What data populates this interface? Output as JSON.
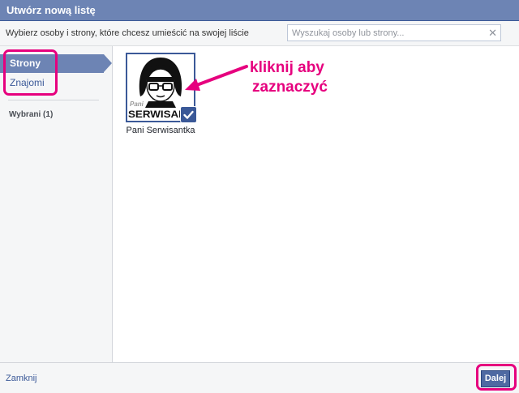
{
  "dialog": {
    "title": "Utwórz nową listę"
  },
  "search": {
    "instruction": "Wybierz osoby i strony, które chcesz umieścić na swojej liście",
    "placeholder": "Wyszukaj osoby lub strony...",
    "clear_symbol": "✕"
  },
  "sidebar": {
    "items": [
      {
        "label": "Strony",
        "active": true
      },
      {
        "label": "Znajomi",
        "active": false
      }
    ],
    "selected_label": "Wybrani (1)"
  },
  "results": [
    {
      "name": "Pani Serwisantka",
      "logo_word_small": "Pani",
      "logo_word_big": "SERWISANT",
      "selected": true
    }
  ],
  "annotation": {
    "line1": "kliknij aby",
    "line2": "zaznaczyć"
  },
  "footer": {
    "close_label": "Zamknij",
    "next_label": "Dalej"
  },
  "colors": {
    "header": "#6d84b4",
    "link": "#3b5998",
    "highlight": "#e6007e",
    "button": "#4e69a2"
  }
}
